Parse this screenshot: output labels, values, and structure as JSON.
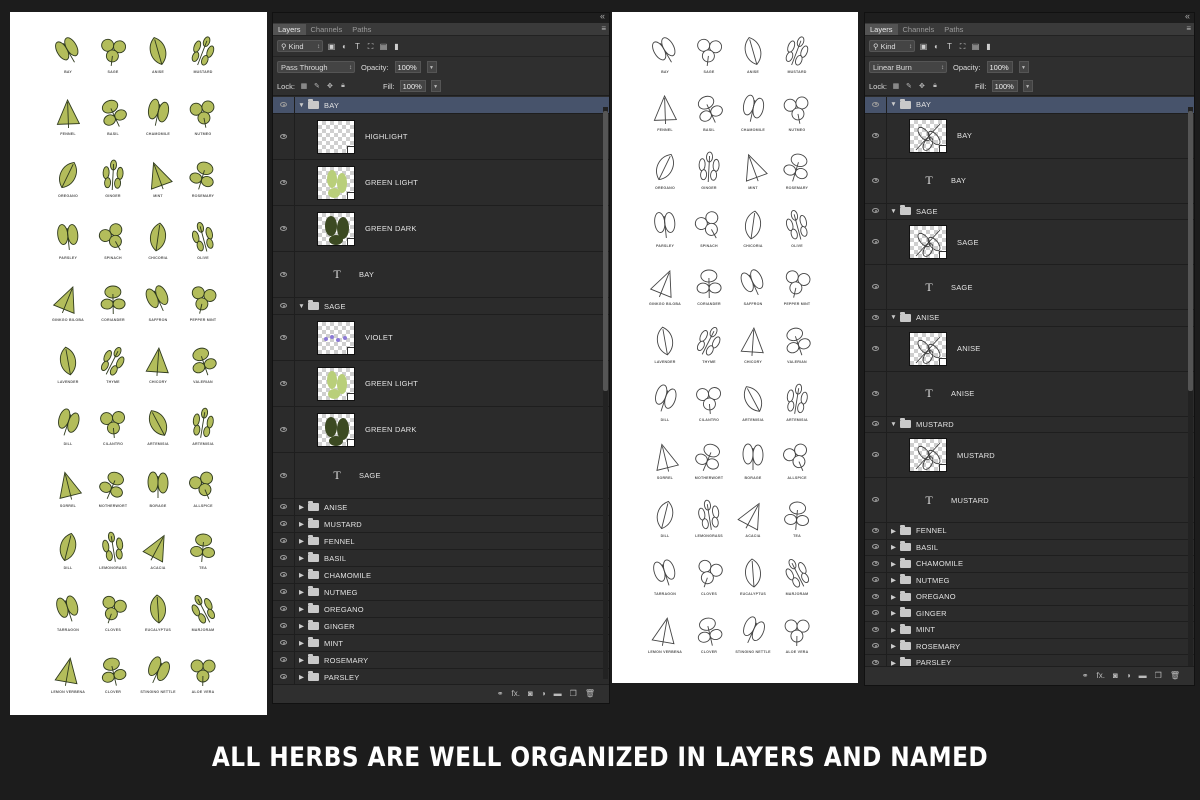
{
  "caption": "ALL HERBS ARE WELL ORGANIZED IN LAYERS AND NAMED",
  "colors": {
    "background": "#1c1c1c",
    "panel": "#2b2b2b",
    "selected_row": "#47536b",
    "herb_fill": "#b3bd5b",
    "herb_line": "#2f3a1e",
    "mono_line": "#444444"
  },
  "herbs": [
    "BAY",
    "SAGE",
    "ANISE",
    "MUSTARD",
    "FENNEL",
    "BASIL",
    "CHAMOMILE",
    "NUTMEG",
    "OREGANO",
    "GINGER",
    "MINT",
    "ROSEMARY",
    "PARSLEY",
    "SPINACH",
    "CHICORIA",
    "OLIVE",
    "GINKGO BILOBA",
    "CORIANDER",
    "SAFFRON",
    "PEPPER MINT",
    "LAVENDER",
    "THYME",
    "CHICORY",
    "VALERIAN",
    "DILL",
    "CILANTRO",
    "ARTEMISIA",
    "ARTEMISIA",
    "SORREL",
    "MOTHERWORT",
    "BORAGE",
    "ALLSPICE",
    "DILL",
    "LEMONGRASS",
    "ACACIA",
    "TEA",
    "TARRAGON",
    "CLOVES",
    "EUCALYPTUS",
    "MARJORAM",
    "LEMON VERBENA",
    "CLOVER",
    "STINGING NETTLE",
    "ALOE VERA"
  ],
  "panel_left": {
    "tabs": [
      "Layers",
      "Channels",
      "Paths"
    ],
    "kind": "Kind",
    "blend_mode": "Pass Through",
    "opacity_label": "Opacity:",
    "opacity": "100%",
    "lock_label": "Lock:",
    "fill_label": "Fill:",
    "fill": "100%",
    "layers": [
      {
        "type": "group",
        "name": "BAY",
        "open": true,
        "selected": true
      },
      {
        "type": "image",
        "name": "HIGHLIGHT",
        "thumb": "blank"
      },
      {
        "type": "image",
        "name": "GREEN LIGHT",
        "thumb": "light"
      },
      {
        "type": "image",
        "name": "GREEN DARK",
        "thumb": "dark"
      },
      {
        "type": "text",
        "name": "BAY"
      },
      {
        "type": "group",
        "name": "SAGE",
        "open": true
      },
      {
        "type": "image",
        "name": "VIOLET",
        "thumb": "violet"
      },
      {
        "type": "image",
        "name": "GREEN LIGHT",
        "thumb": "light"
      },
      {
        "type": "image",
        "name": "GREEN DARK",
        "thumb": "dark"
      },
      {
        "type": "text",
        "name": "SAGE"
      },
      {
        "type": "group",
        "name": "ANISE"
      },
      {
        "type": "group",
        "name": "MUSTARD"
      },
      {
        "type": "group",
        "name": "FENNEL"
      },
      {
        "type": "group",
        "name": "BASIL"
      },
      {
        "type": "group",
        "name": "CHAMOMILE"
      },
      {
        "type": "group",
        "name": "NUTMEG"
      },
      {
        "type": "group",
        "name": "OREGANO"
      },
      {
        "type": "group",
        "name": "GINGER"
      },
      {
        "type": "group",
        "name": "MINT"
      },
      {
        "type": "group",
        "name": "ROSEMARY"
      },
      {
        "type": "group",
        "name": "PARSLEY"
      }
    ]
  },
  "panel_right": {
    "tabs": [
      "Layers",
      "Channels",
      "Paths"
    ],
    "kind": "Kind",
    "blend_mode": "Linear Burn",
    "opacity_label": "Opacity:",
    "opacity": "100%",
    "lock_label": "Lock:",
    "fill_label": "Fill:",
    "fill": "100%",
    "layers": [
      {
        "type": "group",
        "name": "BAY",
        "open": true,
        "selected": true
      },
      {
        "type": "image",
        "name": "BAY",
        "thumb": "sketch"
      },
      {
        "type": "text",
        "name": "BAY"
      },
      {
        "type": "group",
        "name": "SAGE",
        "open": true
      },
      {
        "type": "image",
        "name": "SAGE",
        "thumb": "sketch"
      },
      {
        "type": "text",
        "name": "SAGE"
      },
      {
        "type": "group",
        "name": "ANISE",
        "open": true
      },
      {
        "type": "image",
        "name": "ANISE",
        "thumb": "sketch"
      },
      {
        "type": "text",
        "name": "ANISE"
      },
      {
        "type": "group",
        "name": "MUSTARD",
        "open": true
      },
      {
        "type": "image",
        "name": "MUSTARD",
        "thumb": "sketch"
      },
      {
        "type": "text",
        "name": "MUSTARD"
      },
      {
        "type": "group",
        "name": "FENNEL"
      },
      {
        "type": "group",
        "name": "BASIL"
      },
      {
        "type": "group",
        "name": "CHAMOMILE"
      },
      {
        "type": "group",
        "name": "NUTMEG"
      },
      {
        "type": "group",
        "name": "OREGANO"
      },
      {
        "type": "group",
        "name": "GINGER"
      },
      {
        "type": "group",
        "name": "MINT"
      },
      {
        "type": "group",
        "name": "ROSEMARY"
      },
      {
        "type": "group",
        "name": "PARSLEY"
      }
    ]
  }
}
